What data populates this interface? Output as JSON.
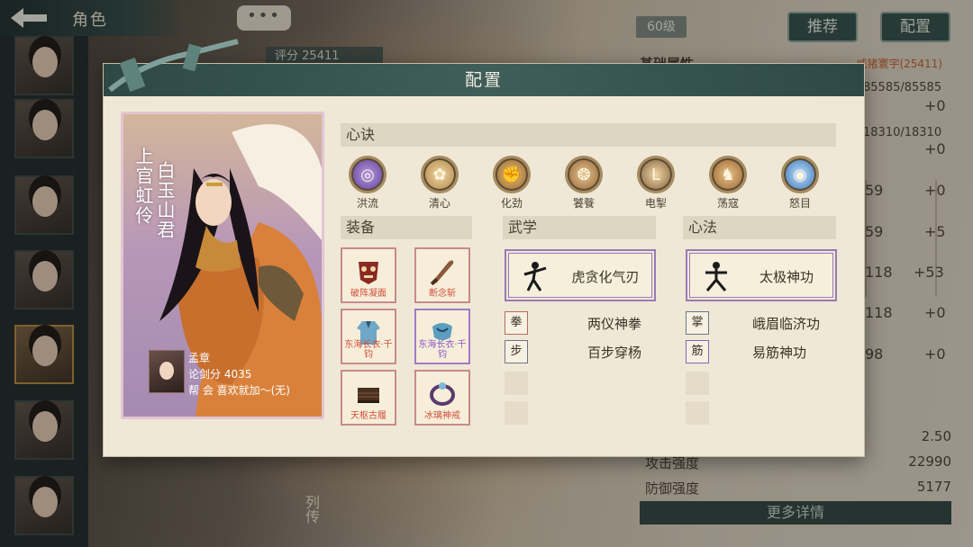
{
  "topbar": {
    "back_title": "角色",
    "chat_label": "•••"
  },
  "background": {
    "score_label": "评分",
    "score_value": "25411",
    "level": "60级",
    "recommend_label": "推荐",
    "config_label": "配置",
    "base_attr_label": "基础属性",
    "base_attr_right": "威猪寰宇(25411)",
    "partial_values": [
      "85585/85585",
      "+0",
      "18310/18310",
      "+0",
      "59",
      "+0",
      "59",
      "+5",
      "118",
      "+53",
      "118",
      "+0",
      "98",
      "+0"
    ],
    "stats": [
      {
        "label": "",
        "value": "2.50"
      },
      {
        "label": "攻击强度",
        "value": "22990"
      },
      {
        "label": "防御强度",
        "value": "5177"
      }
    ],
    "more_label": "更多详情",
    "bio_label": "列传"
  },
  "modal": {
    "title": "配置",
    "character": {
      "name": "上官虹伶",
      "title": "白玉山君",
      "owner_name": "孟章",
      "owner_score": "论剑分 4035",
      "owner_guild": "帮  会 喜欢就加～(无)"
    },
    "xinjue": {
      "header": "心诀",
      "items": [
        {
          "label": "洪流",
          "icon": "swirl-icon",
          "color": "#6e4aa8"
        },
        {
          "label": "清心",
          "icon": "lotus-icon",
          "color": "#b58644"
        },
        {
          "label": "化劲",
          "icon": "fist-icon",
          "color": "#a8762f"
        },
        {
          "label": "饕餮",
          "icon": "beast-icon",
          "color": "#a06a35"
        },
        {
          "label": "电掣",
          "icon": "bolt-icon",
          "color": "#8a6a3a"
        },
        {
          "label": "荡寇",
          "icon": "warrior-icon",
          "color": "#a4682f"
        },
        {
          "label": "怒目",
          "icon": "eye-icon",
          "color": "#3c78b8"
        }
      ]
    },
    "equipment": {
      "header": "装备",
      "items": [
        {
          "label": "破阵凝面",
          "icon": "mask-icon"
        },
        {
          "label": "断念斩",
          "icon": "blade-icon"
        },
        {
          "label": "东海长衣·千钧",
          "icon": "robe-icon"
        },
        {
          "label": "东海长衣·千钧",
          "icon": "robe-icon"
        },
        {
          "label": "天枢古履",
          "icon": "boots-icon"
        },
        {
          "label": "冰璃神戒",
          "icon": "ring-icon"
        }
      ]
    },
    "wuxue": {
      "header": "武学",
      "main": "虎贪化气刃",
      "subs": [
        "两仪神拳",
        "百步穿杨"
      ]
    },
    "xinfa": {
      "header": "心法",
      "main": "太极神功",
      "subs": [
        "峨眉临济功",
        "易筋神功"
      ]
    }
  }
}
